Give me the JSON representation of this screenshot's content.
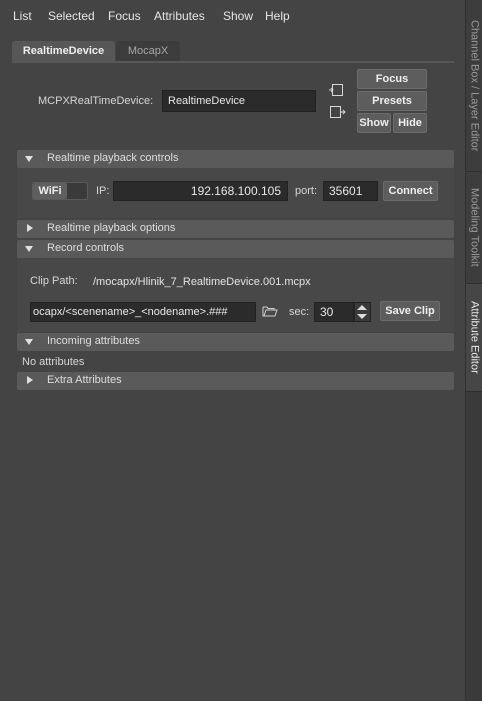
{
  "menu": [
    "List",
    "Selected",
    "Focus",
    "Attributes",
    "Show",
    "Help"
  ],
  "tabs": [
    {
      "label": "RealtimeDevice",
      "active": true
    },
    {
      "label": "MocapX",
      "active": false
    }
  ],
  "node": {
    "label": "MCPXRealTimeDevice:",
    "value": "RealtimeDevice",
    "buttons": {
      "focus": "Focus",
      "presets": "Presets",
      "show": "Show",
      "hide": "Hide"
    }
  },
  "sections": {
    "playback_controls": "Realtime playback controls",
    "playback_options": "Realtime playback options",
    "record_controls": "Record controls",
    "incoming_attributes": "Incoming attributes",
    "extra_attributes": "Extra Attributes"
  },
  "playback": {
    "wifi_label": "WiFi",
    "ip_label": "IP:",
    "ip_value": "192.168.100.105",
    "port_label": "port:",
    "port_value": "35601",
    "connect_label": "Connect"
  },
  "record": {
    "clip_path_label": "Clip Path:",
    "clip_path_value": "/mocapx/Hlinik_7_RealtimeDevice.001.mcpx",
    "template_value": "ocapx/<scenename>_<nodename>.###",
    "sec_label": "sec:",
    "sec_value": "30",
    "save_clip_label": "Save Clip"
  },
  "incoming": {
    "empty_text": "No attributes"
  },
  "right_dock": [
    "Channel Box / Layer Editor",
    "Modeling Toolkit",
    "Attribute Editor"
  ],
  "colors": {
    "background": "#444444",
    "section_header": "#5a5a5a",
    "field": "#2b2b2b"
  },
  "icons": [
    "select-node-icon",
    "select-node-arrow-icon",
    "folder-open-icon",
    "spin-up-icon",
    "spin-down-icon",
    "expand-triangle-icon",
    "collapse-triangle-icon"
  ]
}
